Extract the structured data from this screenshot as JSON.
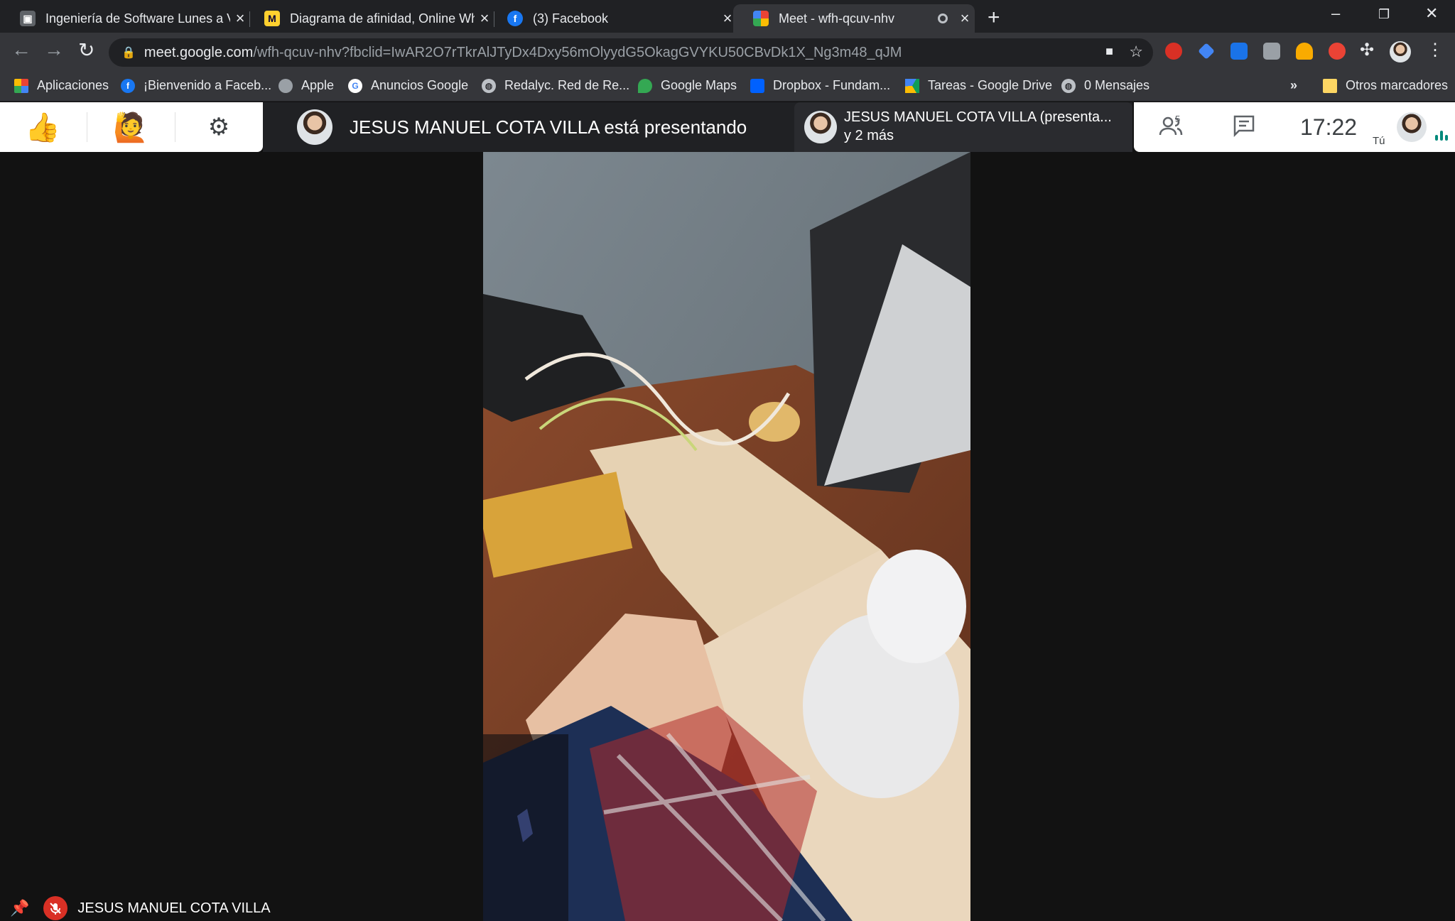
{
  "browser": {
    "tabs": [
      {
        "title": "Ingeniería de Software Lunes a Vi",
        "favicon": "classroom-icon",
        "active": false
      },
      {
        "title": "Diagrama de afinidad, Online Wh",
        "favicon": "miro-icon",
        "active": false
      },
      {
        "title": "(3) Facebook",
        "favicon": "facebook-icon",
        "active": false
      },
      {
        "title": "Meet - wfh-qcuv-nhv",
        "favicon": "meet-icon",
        "active": true
      }
    ],
    "url_host": "meet.google.com",
    "url_path": "/wfh-qcuv-nhv?fbclid=IwAR2O7rTkrAlJTyDx4Dxy56mOlyydG5OkagGVYKU50CBvDk1X_Ng3m48_qJM",
    "bookmarks": [
      {
        "label": "Aplicaciones",
        "icon": "apps-grid-icon"
      },
      {
        "label": "¡Bienvenido a Faceb...",
        "icon": "facebook-icon"
      },
      {
        "label": "Apple",
        "icon": "apple-icon"
      },
      {
        "label": "Anuncios Google",
        "icon": "google-icon"
      },
      {
        "label": "Redalyc. Red de Re...",
        "icon": "globe-icon"
      },
      {
        "label": "Google Maps",
        "icon": "maps-icon"
      },
      {
        "label": "Dropbox - Fundam...",
        "icon": "dropbox-icon"
      },
      {
        "label": "Tareas - Google Drive",
        "icon": "drive-icon"
      },
      {
        "label": "0 Mensajes",
        "icon": "globe-icon"
      }
    ],
    "more_bookmarks": "»",
    "other_bookmarks": "Otros marcadores"
  },
  "meet": {
    "presenting_text": "JESUS MANUEL COTA VILLA está presentando",
    "presenter_line1": "JESUS MANUEL COTA VILLA (presenta...",
    "presenter_line2": "y 2 más",
    "participant_count": "5",
    "clock": "17:22",
    "self_label": "Tú",
    "bottom_name": "JESUS MANUEL COTA VILLA"
  },
  "colors": {
    "mic_off": "#d93025",
    "meet_accent": "#00897b"
  }
}
